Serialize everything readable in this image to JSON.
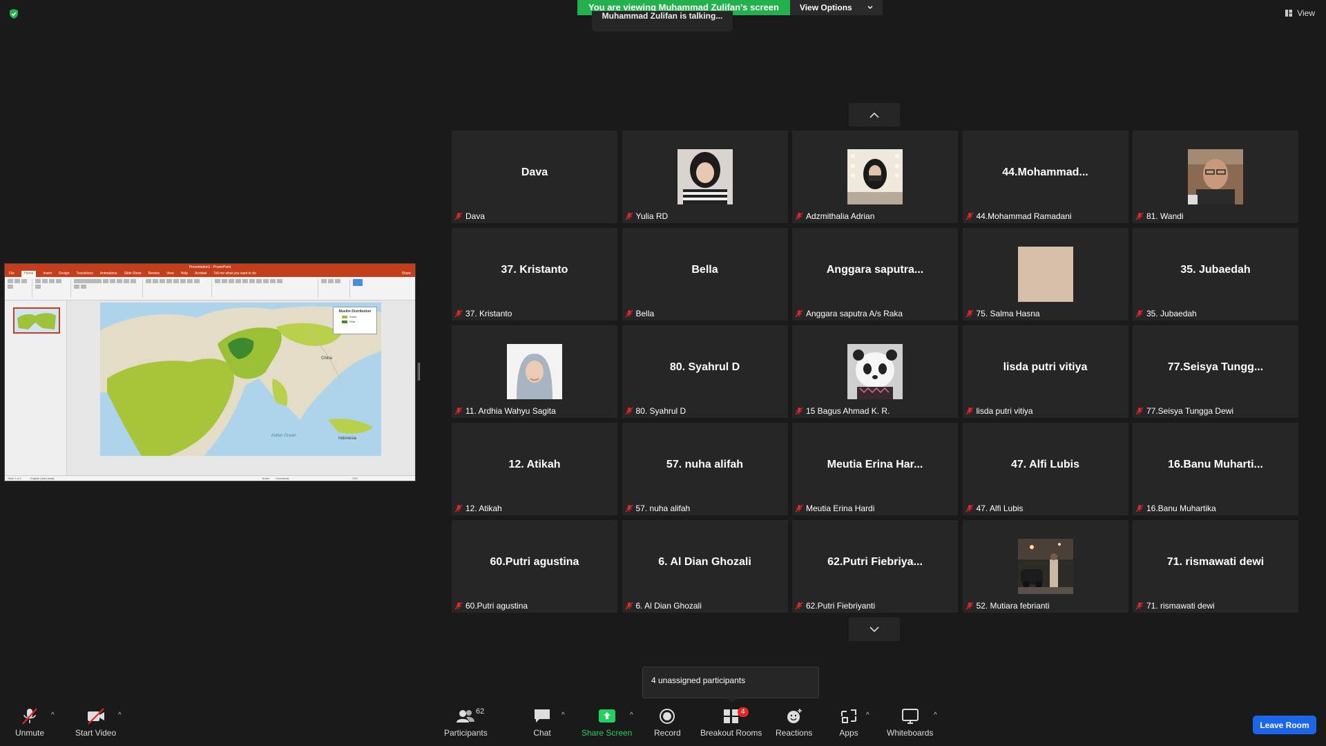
{
  "banner": {
    "viewing_text": "You are viewing Muhammad Zulifan's screen",
    "view_options": "View Options",
    "talking": "Muhammad Zulifan is talking..."
  },
  "view_button": "View",
  "share": {
    "window_title": "Presentation1 - PowerPoint",
    "tabs": [
      "File",
      "Home",
      "Insert",
      "Design",
      "Transitions",
      "Animations",
      "Slide Show",
      "Review",
      "View",
      "Help",
      "Acrobat"
    ],
    "tell_me": "Tell me what you want to do",
    "share_label": "Share",
    "legend_title": "Muslim Distribution",
    "legend_items": [
      "Sunni",
      "Shia"
    ],
    "map_labels": [
      "China",
      "Indian Ocean",
      "Indonesia"
    ],
    "status_text": "Slide 1 of 1",
    "language": "English (Indonesia)",
    "notes": "Notes",
    "comments": "Comments",
    "zoom": "73%"
  },
  "participants": [
    {
      "display": "Dava",
      "label": "Dava",
      "photo": null
    },
    {
      "display": "",
      "label": "Yulia RD",
      "photo": "woman-dark-hair"
    },
    {
      "display": "",
      "label": "Adzmithalia Adrian",
      "photo": "woman-hijab-mirror"
    },
    {
      "display": "44.Mohammad...",
      "label": "44.Mohammad Ramadani",
      "photo": null
    },
    {
      "display": "",
      "label": "81. Wandi",
      "photo": "man-glasses"
    },
    {
      "display": "37. Kristanto",
      "label": "37. Kristanto",
      "photo": null
    },
    {
      "display": "Bella",
      "label": "Bella",
      "photo": null
    },
    {
      "display": "Anggara saputra...",
      "label": "Anggara saputra A/s Raka",
      "photo": null
    },
    {
      "display": "",
      "label": "75. Salma Hasna",
      "photo": "beige-square"
    },
    {
      "display": "35. Jubaedah",
      "label": "35. Jubaedah",
      "photo": null
    },
    {
      "display": "",
      "label": "11. Ardhia Wahyu Sagita",
      "photo": "woman-hijab-portrait"
    },
    {
      "display": "80. Syahrul D",
      "label": "80. Syahrul D",
      "photo": null
    },
    {
      "display": "",
      "label": "15 Bagus Ahmad K. R.",
      "photo": "panda"
    },
    {
      "display": "lisda putri vitiya",
      "label": "lisda putri vitiya",
      "photo": null
    },
    {
      "display": "77.Seisya Tungg...",
      "label": "77.Seisya Tungga Dewi",
      "photo": null
    },
    {
      "display": "12. Atikah",
      "label": "12. Atikah",
      "photo": null
    },
    {
      "display": "57. nuha alifah",
      "label": "57. nuha alifah",
      "photo": null
    },
    {
      "display": "Meutia Erina Har...",
      "label": "Meutia Erina Hardi",
      "photo": null
    },
    {
      "display": "47. Alfi Lubis",
      "label": "47. Alfi Lubis",
      "photo": null
    },
    {
      "display": "16.Banu Muharti...",
      "label": "16.Banu Muhartika",
      "photo": null
    },
    {
      "display": "60.Putri agustina",
      "label": "60.Putri agustina",
      "photo": null
    },
    {
      "display": "6. Al Dian Ghozali",
      "label": "6. Al Dian Ghozali",
      "photo": null
    },
    {
      "display": "62.Putri Fiebriya...",
      "label": "62.Putri Fiebriyanti",
      "photo": null
    },
    {
      "display": "",
      "label": "52. Mutiara febrianti",
      "photo": "street-night"
    },
    {
      "display": "71. rismawati dewi",
      "label": "71. rismawati dewi",
      "photo": null
    }
  ],
  "popup": {
    "text": "4 unassigned participants"
  },
  "toolbar": {
    "unmute": "Unmute",
    "start_video": "Start Video",
    "participants": "Participants",
    "participants_count": "62",
    "chat": "Chat",
    "share_screen": "Share Screen",
    "record": "Record",
    "breakout_rooms": "Breakout Rooms",
    "breakout_badge": "4",
    "reactions": "Reactions",
    "apps": "Apps",
    "whiteboards": "Whiteboards",
    "leave": "Leave Room"
  },
  "colors": {
    "banner_green": "#23b14d",
    "leave_blue": "#1a65e8",
    "mute_red": "#e02828",
    "tile_bg": "#262626",
    "ppt_red": "#c43e1c"
  }
}
